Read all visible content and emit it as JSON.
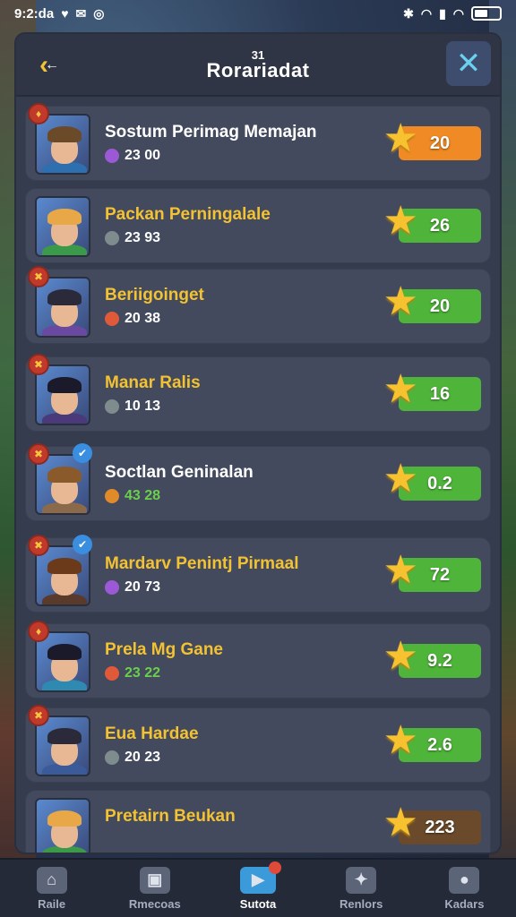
{
  "status": {
    "time": "9:2:da"
  },
  "header": {
    "title_top": "31",
    "title": "Rorariadat"
  },
  "rows": [
    {
      "name": "Sostum Perimag Memajan",
      "sub": "23 00",
      "score": "20",
      "name_color": "#ffffff",
      "sub_color": "#ffffff",
      "score_color": "#f08a24",
      "gem_color": "#9b59d6",
      "hair": "#6b4a2a",
      "body": "#2e6fb0",
      "badge": "♦",
      "blue": ""
    },
    {
      "name": "Packan Perningalale",
      "sub": "23 93",
      "score": "26",
      "name_color": "#f3c233",
      "sub_color": "#ffffff",
      "score_color": "#4fb53a",
      "gem_color": "#7f8c8d",
      "hair": "#e8a848",
      "body": "#3a9a4a",
      "badge": "",
      "blue": ""
    },
    {
      "name": "Beriigoinget",
      "sub": "20 38",
      "score": "20",
      "name_color": "#f3c233",
      "sub_color": "#ffffff",
      "score_color": "#4fb53a",
      "gem_color": "#e05a3a",
      "hair": "#2a2a3a",
      "body": "#6a4aa0",
      "badge": "✖",
      "blue": ""
    },
    {
      "name": "Manar Ralis",
      "sub": "10 13",
      "score": "16",
      "name_color": "#f3c233",
      "sub_color": "#ffffff",
      "score_color": "#4fb53a",
      "gem_color": "#7f8c8d",
      "hair": "#1a1a2a",
      "body": "#4a3a7a",
      "badge": "✖",
      "blue": ""
    },
    {
      "name": "Soctlan Geninalan",
      "sub": "43 28",
      "score": "0.2",
      "name_color": "#ffffff",
      "sub_color": "#6ad04a",
      "score_color": "#4fb53a",
      "gem_color": "#e08a2a",
      "hair": "#8a5a2a",
      "body": "#8a6a4a",
      "badge": "✖",
      "blue": "✔"
    },
    {
      "name": "Mardarv Penintj Pirmaal",
      "sub": "20 73",
      "score": "72",
      "name_color": "#f3c233",
      "sub_color": "#ffffff",
      "score_color": "#4fb53a",
      "gem_color": "#9b59d6",
      "hair": "#6a3a1a",
      "body": "#5a3a2a",
      "badge": "✖",
      "blue": "✔"
    },
    {
      "name": "Prela Mg Gane",
      "sub": "23 22",
      "score": "9.2",
      "name_color": "#f3c233",
      "sub_color": "#6ad04a",
      "score_color": "#4fb53a",
      "gem_color": "#e05a3a",
      "hair": "#1a1a2a",
      "body": "#2e8ab0",
      "badge": "♦",
      "blue": ""
    },
    {
      "name": "Eua Hardae",
      "sub": "20 23",
      "score": "2.6",
      "name_color": "#f3c233",
      "sub_color": "#ffffff",
      "score_color": "#4fb53a",
      "gem_color": "#7f8c8d",
      "hair": "#2a2a3a",
      "body": "#3a5a9a",
      "badge": "✖",
      "blue": ""
    },
    {
      "name": "Pretairn Beukan",
      "sub": "",
      "score": "223",
      "name_color": "#f3c233",
      "sub_color": "#ffffff",
      "score_color": "#6a4a2a",
      "gem_color": "#7f8c8d",
      "hair": "#e8a848",
      "body": "#3a9a4a",
      "badge": "",
      "blue": ""
    }
  ],
  "nav": [
    {
      "label": "Raile",
      "icon": "home-icon",
      "glyph": "⌂"
    },
    {
      "label": "Rmecoas",
      "icon": "image-icon",
      "glyph": "▣"
    },
    {
      "label": "Sutota",
      "icon": "play-icon",
      "glyph": "▶"
    },
    {
      "label": "Renlors",
      "icon": "puzzle-icon",
      "glyph": "✦"
    },
    {
      "label": "Kadars",
      "icon": "bomb-icon",
      "glyph": "●"
    }
  ]
}
